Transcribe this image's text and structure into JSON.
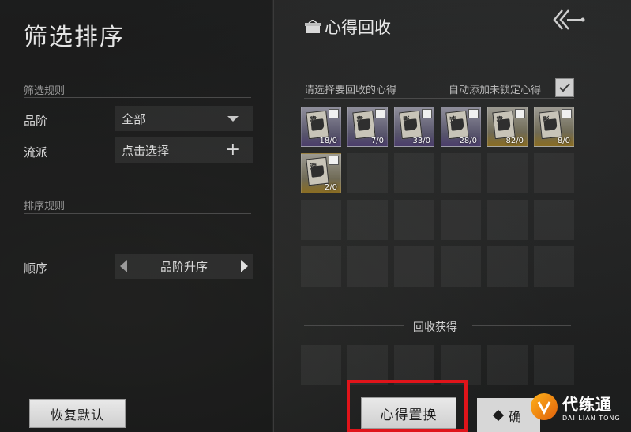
{
  "left": {
    "title": "筛选排序",
    "filter_section": "筛选规则",
    "tier_label": "品阶",
    "tier_value": "全部",
    "school_label": "流派",
    "school_value": "点击选择",
    "sort_section": "排序规则",
    "order_label": "顺序",
    "order_value": "品阶升序",
    "reset_button": "恢复默认"
  },
  "right": {
    "title": "心得回收",
    "hint": "请选择要回收的心得",
    "auto_add_label": "自动添加未锁定心得",
    "auto_add_checked": true,
    "items": [
      {
        "tag": "靠",
        "count": "18/0",
        "rarity": "purple"
      },
      {
        "tag": "靠",
        "count": "7/0",
        "rarity": "purple"
      },
      {
        "tag": "影",
        "count": "33/0",
        "rarity": "purple"
      },
      {
        "tag": "速",
        "count": "28/0",
        "rarity": "purple"
      },
      {
        "tag": "靠",
        "count": "82/0",
        "rarity": "gold"
      },
      {
        "tag": "影",
        "count": "8/0",
        "rarity": "gold"
      },
      {
        "tag": "速",
        "count": "2/0",
        "rarity": "gold"
      }
    ],
    "reward_title": "回收获得",
    "replace_button": "心得置换",
    "confirm_button": "确"
  },
  "watermark": {
    "main": "代练通",
    "sub": "DAI LIAN TONG"
  },
  "colors": {
    "highlight": "#e0141a",
    "purple_item": "#57546b",
    "gold_item": "#8a6d22"
  }
}
